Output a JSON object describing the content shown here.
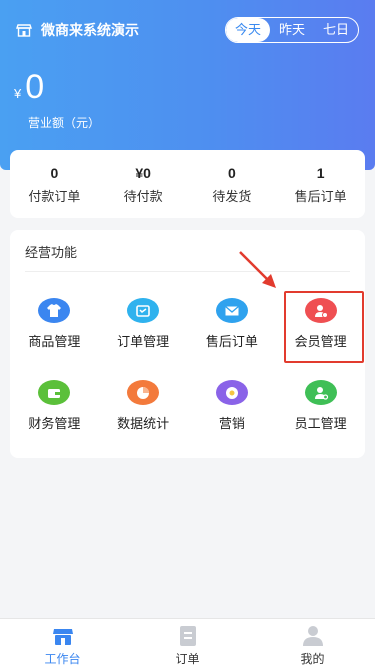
{
  "header": {
    "shop_name": "微商来系统演示",
    "shop_icon": "store-icon",
    "periods": [
      {
        "label": "今天",
        "active": true
      },
      {
        "label": "昨天",
        "active": false
      },
      {
        "label": "七日",
        "active": false
      }
    ],
    "currency": "¥",
    "revenue": "0",
    "revenue_label": "营业额（元）"
  },
  "stats": [
    {
      "value": "0",
      "label": "付款订单"
    },
    {
      "value": "¥0",
      "label": "待付款"
    },
    {
      "value": "0",
      "label": "待发货"
    },
    {
      "value": "1",
      "label": "售后订单"
    }
  ],
  "functions": {
    "title": "经营功能",
    "items": [
      {
        "label": "商品管理",
        "icon": "shirt-icon",
        "color": "#3b86f0"
      },
      {
        "label": "订单管理",
        "icon": "cart-icon",
        "color": "#2fb2ee"
      },
      {
        "label": "售后订单",
        "icon": "mail-icon",
        "color": "#2fa2ee"
      },
      {
        "label": "会员管理",
        "icon": "member-icon",
        "color": "#ef4f52"
      },
      {
        "label": "财务管理",
        "icon": "wallet-icon",
        "color": "#5bc03a"
      },
      {
        "label": "数据统计",
        "icon": "pie-chart-icon",
        "color": "#f37a3c"
      },
      {
        "label": "营销",
        "icon": "flower-icon",
        "color": "#8a63e8"
      },
      {
        "label": "员工管理",
        "icon": "staff-icon",
        "color": "#3fbf56"
      }
    ]
  },
  "tabbar": [
    {
      "label": "工作台",
      "icon": "workbench-icon",
      "active": true
    },
    {
      "label": "订单",
      "icon": "order-icon",
      "active": false
    },
    {
      "label": "我的",
      "icon": "profile-icon",
      "active": false
    }
  ],
  "colors": {
    "accent": "#3a86f0",
    "highlight": "#e23b2e",
    "inactive_icon": "#c9ccd2"
  }
}
